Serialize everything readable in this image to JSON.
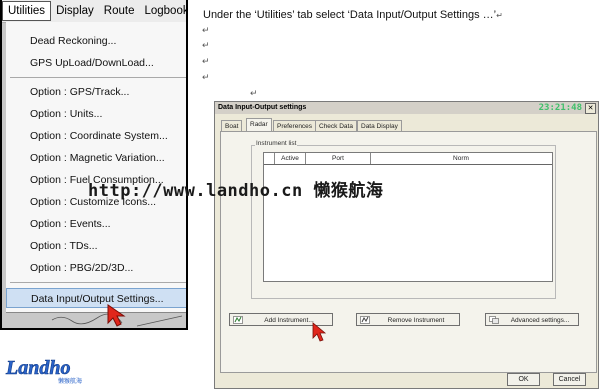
{
  "menu_screenshot": {
    "menubar": [
      "Utilities",
      "Display",
      "Route",
      "Logbook"
    ],
    "menu_items": [
      "Dead Reckoning...",
      "GPS UpLoad/DownLoad...",
      "Option : GPS/Track...",
      "Option : Units...",
      "Option : Coordinate System...",
      "Option : Magnetic Variation...",
      "Option : Fuel Consumption...",
      "Option : Customize Icons...",
      "Option : Events...",
      "Option : TDs...",
      "Option : PBG/2D/3D...",
      "Data Input/Output Settings..."
    ],
    "selected_item": "Data Input/Output Settings..."
  },
  "instruction": "Under the ‘Utilities’ tab select ‘Data Input/Output Settings …’",
  "paragraph_mark": "↵",
  "dialog": {
    "title": "Data Input-Output settings",
    "clock": "23:21:48",
    "close_glyph": "✕",
    "tabs": [
      "Boat",
      "Radar",
      "Preferences",
      "Check Data",
      "Data Display"
    ],
    "active_tab": "Radar",
    "group_label": "Instrument list",
    "columns": [
      "Active",
      "Port",
      "Norm"
    ],
    "buttons": {
      "add": "Add Instrument...",
      "remove": "Remove Instrument",
      "advanced": "Advanced settings..."
    },
    "ok": "OK",
    "cancel": "Cancel"
  },
  "watermark": "http://www.landho.cn 懒猴航海",
  "logo": {
    "brand": "Landho",
    "tagline": "懒猴航海"
  },
  "colors": {
    "selection": "#cfe0f3",
    "cursor_red": "#e0261b",
    "clock_green": "#3fbf6a",
    "logo_blue": "#2a63c9"
  }
}
